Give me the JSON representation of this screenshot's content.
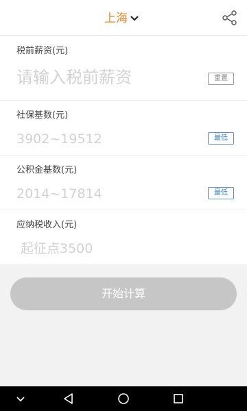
{
  "header": {
    "city": "上海",
    "chevron_icon": "chevron-down-icon",
    "share_icon": "share-icon"
  },
  "form": {
    "salary": {
      "label": "税前薪资(元)",
      "placeholder": "请输入税前薪资",
      "value": "",
      "button_label": "重置"
    },
    "social_security": {
      "label": "社保基数(元)",
      "placeholder": "3902~19512",
      "value": "",
      "button_label": "最低"
    },
    "housing_fund": {
      "label": "公积金基数(元)",
      "placeholder": "2014~17814",
      "value": "",
      "button_label": "最低"
    },
    "taxable_income": {
      "label": "应纳税收入(元)",
      "placeholder": "起征点3500",
      "value": ""
    }
  },
  "calculate_button": "开始计算",
  "colors": {
    "accent": "#e8862a",
    "button_disabled": "#c6c6c6",
    "link_blue": "#3f7dbd"
  },
  "navbar": {
    "icons": [
      "chevron-down-icon",
      "back-icon",
      "home-icon",
      "recents-icon"
    ]
  }
}
